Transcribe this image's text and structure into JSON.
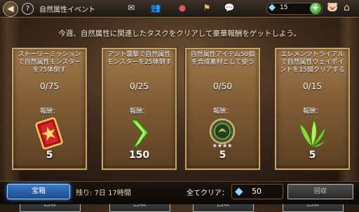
{
  "header": {
    "back_icon": "back-arrow-icon",
    "help_label": "?",
    "title": "自然属性イベント",
    "tabs": [
      "mail-icon",
      "people-icon",
      "pin-icon",
      "flag-icon",
      "chat-icon"
    ],
    "gems": "15",
    "plus_label": "+"
  },
  "headline": "今週、自然属性に関連したタスクをクリアして豪華報酬をゲットしよう。",
  "cards": [
    {
      "desc": "ストーリーミッションで自然属性モンスターを75体倒す",
      "progress": "0/75",
      "reward_label": "報酬：",
      "reward_icon": "card-icon",
      "reward_count": "5",
      "button": "回収"
    },
    {
      "desc": "アジト襲撃で自然属性モンスターを25体倒す",
      "progress": "0/25",
      "reward_label": "報酬：",
      "reward_icon": "arrow-icon",
      "reward_count": "150",
      "button": "回収"
    },
    {
      "desc": "自然属性アイテム50個を合成素材として使う",
      "progress": "0/50",
      "reward_label": "報酬：",
      "reward_icon": "medal-icon",
      "reward_count": "5",
      "button": "回収"
    },
    {
      "desc": "エレメンツトライアルで自然属性ウェイポイントを15個クリアする",
      "progress": "0/15",
      "reward_label": "報酬：",
      "reward_icon": "leaf-icon",
      "reward_count": "5",
      "button": "回収"
    }
  ],
  "footer": {
    "chest_button": "宝箱",
    "remaining": "残り: 7日 17時間",
    "all_clear_label": "全てクリア：",
    "all_clear_gems": "50",
    "claim_all_button": "回収"
  }
}
